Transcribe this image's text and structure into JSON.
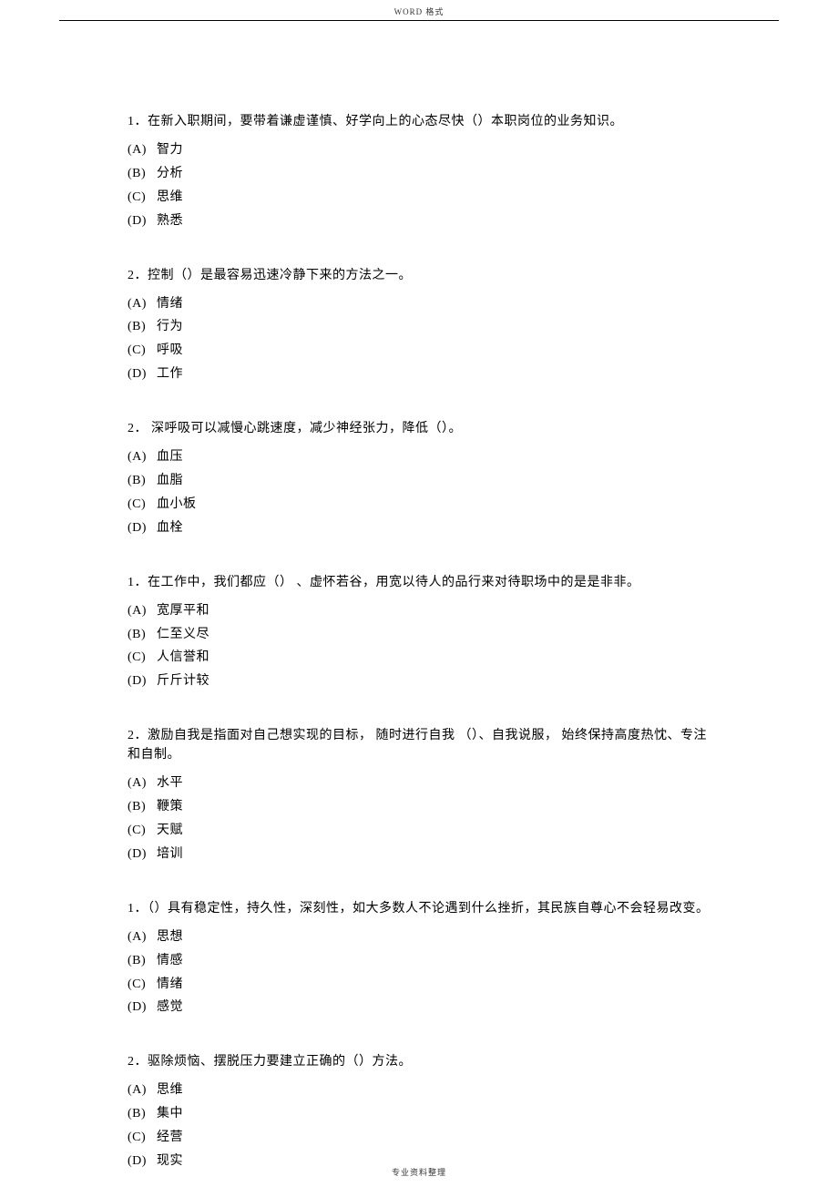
{
  "header": "WORD 格式",
  "footer": "专业资料整理",
  "questions": [
    {
      "text": "1．在新入职期间，要带着谦虚谨慎、好学向上的心态尽快（）本职岗位的业务知识。",
      "options": [
        {
          "label": "(A)",
          "text": "智力"
        },
        {
          "label": "(B)",
          "text": "分析"
        },
        {
          "label": "(C)",
          "text": "思维"
        },
        {
          "label": "(D)",
          "text": "熟悉"
        }
      ]
    },
    {
      "text": "2．控制（）是最容易迅速冷静下来的方法之一。",
      "options": [
        {
          "label": "(A)",
          "text": "情绪"
        },
        {
          "label": "(B)",
          "text": "行为"
        },
        {
          "label": "(C)",
          "text": "呼吸"
        },
        {
          "label": "(D)",
          "text": "工作"
        }
      ]
    },
    {
      "text": "2．  深呼吸可以减慢心跳速度，减少神经张力，降低（）。",
      "options": [
        {
          "label": "(A)",
          "text": "血压"
        },
        {
          "label": "(B)",
          "text": "血脂"
        },
        {
          "label": "(C)",
          "text": "血小板"
        },
        {
          "label": "(D)",
          "text": "血栓"
        }
      ]
    },
    {
      "text": "1．在工作中，我们都应（）  、虚怀若谷，用宽以待人的品行来对待职场中的是是非非。",
      "options": [
        {
          "label": "(A)",
          "text": "宽厚平和"
        },
        {
          "label": "(B)",
          "text": "仁至义尽"
        },
        {
          "label": "(C)",
          "text": "人信誉和"
        },
        {
          "label": "(D)",
          "text": "斤斤计较"
        }
      ]
    },
    {
      "text": "2．激励自我是指面对自己想实现的目标，  随时进行自我  （）、自我说服，  始终保持高度热忱、专注和自制。",
      "options": [
        {
          "label": "(A)",
          "text": "水平"
        },
        {
          "label": "(B)",
          "text": "鞭策"
        },
        {
          "label": "(C)",
          "text": "天赋"
        },
        {
          "label": "(D)",
          "text": "培训"
        }
      ]
    },
    {
      "text": "1．（）具有稳定性，持久性，深刻性，如大多数人不论遇到什么挫折，其民族自尊心不会轻易改变。",
      "options": [
        {
          "label": "(A)",
          "text": "思想"
        },
        {
          "label": "(B)",
          "text": "情感"
        },
        {
          "label": "(C)",
          "text": "情绪"
        },
        {
          "label": "(D)",
          "text": "感觉"
        }
      ]
    },
    {
      "text": "2．驱除烦恼、摆脱压力要建立正确的（）方法。",
      "options": [
        {
          "label": "(A)",
          "text": "思维"
        },
        {
          "label": "(B)",
          "text": "集中"
        },
        {
          "label": "(C)",
          "text": "经营"
        },
        {
          "label": "(D)",
          "text": "现实"
        }
      ]
    }
  ]
}
